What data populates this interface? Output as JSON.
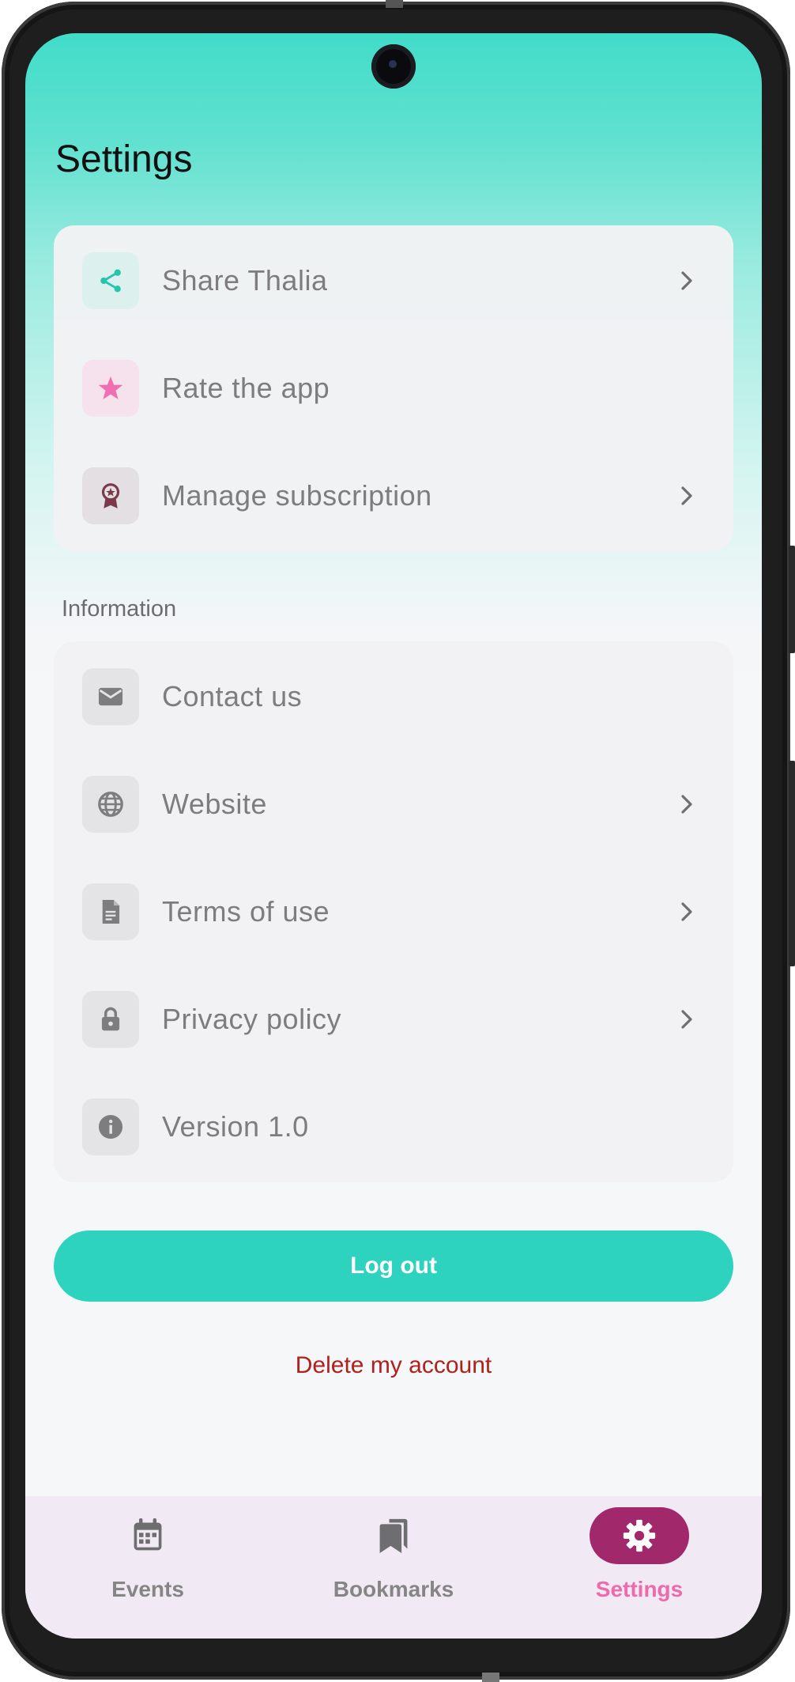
{
  "header": {
    "title": "Settings"
  },
  "general_card": {
    "items": [
      {
        "label": "Share Thalia",
        "icon": "share-icon",
        "has_chevron": true,
        "icon_color": "#26c4ae",
        "icon_bg": "#dcf1ee"
      },
      {
        "label": "Rate the app",
        "icon": "star-icon",
        "has_chevron": false,
        "icon_color": "#f06fb0",
        "icon_bg": "#f6e2ec"
      },
      {
        "label": "Manage subscription",
        "icon": "award-ribbon-icon",
        "has_chevron": true,
        "icon_color": "#7b3a4c",
        "icon_bg": "#e4dfe2"
      }
    ]
  },
  "information": {
    "title": "Information",
    "items": [
      {
        "label": "Contact us",
        "icon": "mail-icon",
        "has_chevron": false
      },
      {
        "label": "Website",
        "icon": "globe-icon",
        "has_chevron": true
      },
      {
        "label": "Terms of use",
        "icon": "document-icon",
        "has_chevron": true
      },
      {
        "label": "Privacy policy",
        "icon": "lock-icon",
        "has_chevron": true
      },
      {
        "label": "Version 1.0",
        "icon": "info-icon",
        "has_chevron": false
      }
    ]
  },
  "actions": {
    "logout_label": "Log out",
    "delete_label": "Delete my account"
  },
  "bottom_nav": {
    "items": [
      {
        "label": "Events",
        "icon": "calendar-icon",
        "active": false
      },
      {
        "label": "Bookmarks",
        "icon": "bookmarks-icon",
        "active": false
      },
      {
        "label": "Settings",
        "icon": "gear-icon",
        "active": true
      }
    ]
  },
  "colors": {
    "accent": "#2ed3bf",
    "danger": "#b0201c",
    "active_nav_bg": "#a0286b",
    "active_nav_label": "#ee6aaa"
  }
}
